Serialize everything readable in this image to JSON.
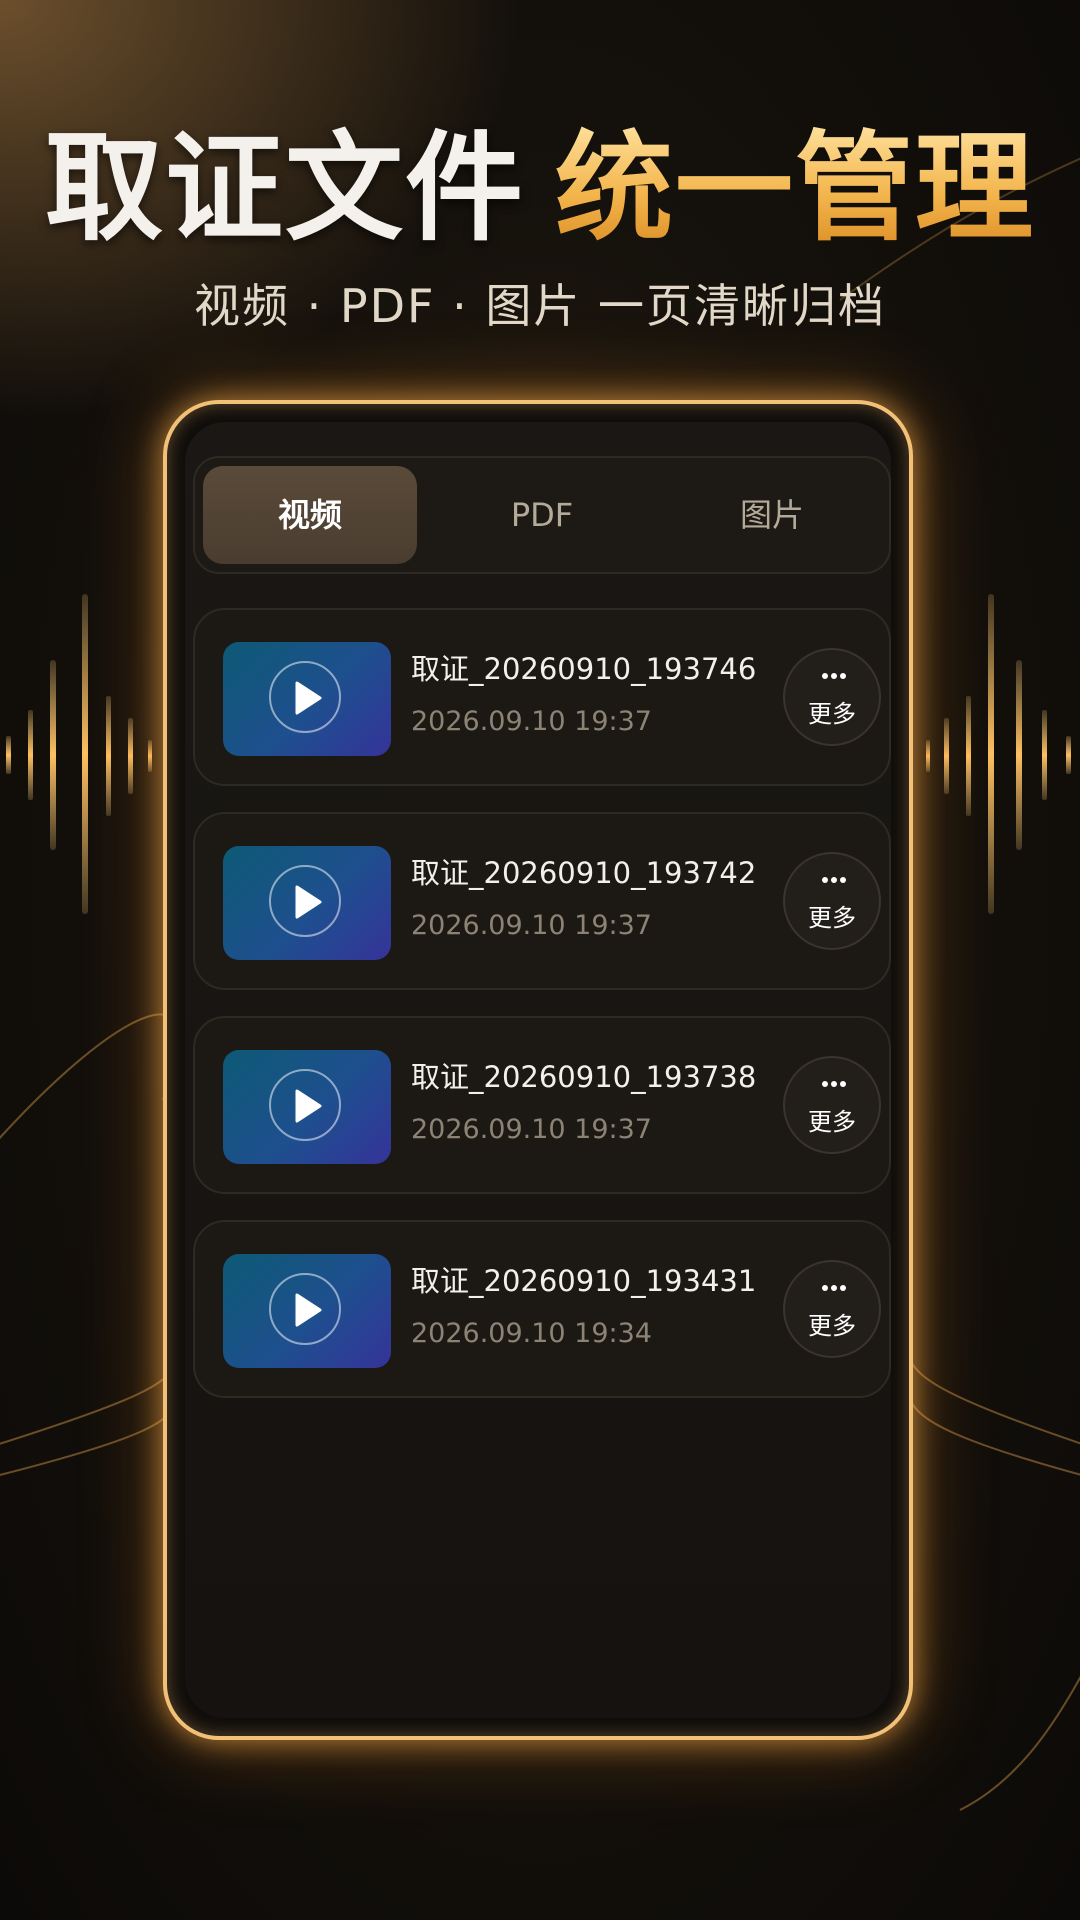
{
  "headline": {
    "part1": "取证文件",
    "part2": "统一管理"
  },
  "subtitle": "视频 · PDF · 图片 一页清晰归档",
  "tabs": [
    {
      "label": "视频",
      "active": true
    },
    {
      "label": "PDF",
      "active": false
    },
    {
      "label": "图片",
      "active": false
    }
  ],
  "files": [
    {
      "name": "取证_20260910_193746",
      "date": "2026.09.10 19:37",
      "more_label": "更多",
      "icon": "play-icon"
    },
    {
      "name": "取证_20260910_193742",
      "date": "2026.09.10 19:37",
      "more_label": "更多",
      "icon": "play-icon"
    },
    {
      "name": "取证_20260910_193738",
      "date": "2026.09.10 19:37",
      "more_label": "更多",
      "icon": "play-icon"
    },
    {
      "name": "取证_20260910_193431",
      "date": "2026.09.10 19:34",
      "more_label": "更多",
      "icon": "play-icon"
    }
  ],
  "colors": {
    "accent_gold": "#f0b84e",
    "background": "#15110c",
    "thumbnail_start": "#0d5a75",
    "thumbnail_end": "#35339a"
  }
}
